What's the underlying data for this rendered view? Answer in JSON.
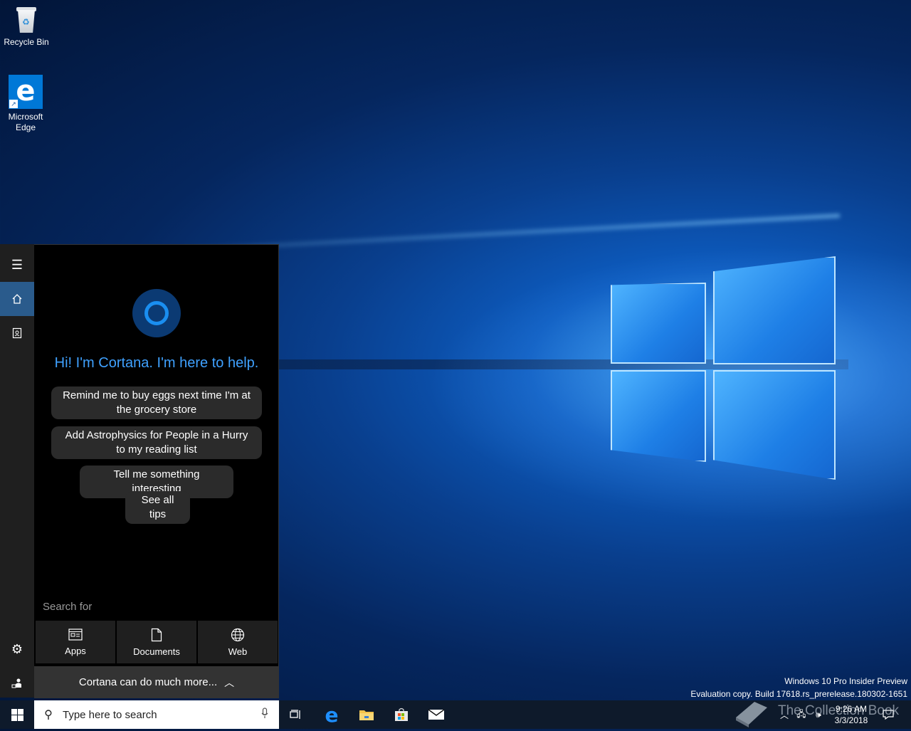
{
  "desktop": {
    "icons": [
      {
        "label": "Recycle Bin",
        "icon": "recycle-bin-icon"
      },
      {
        "label": "Microsoft Edge",
        "icon": "edge-icon"
      }
    ]
  },
  "cortana": {
    "greeting": "Hi! I'm Cortana. I'm here to help.",
    "suggestions": [
      "Remind me to buy eggs next time I'm at the grocery store",
      "Add Astrophysics for People in a Hurry to my reading list",
      "Tell me something interesting",
      "See all tips"
    ],
    "search_for_label": "Search for",
    "search_buttons": [
      {
        "label": "Apps",
        "icon": "apps-icon"
      },
      {
        "label": "Documents",
        "icon": "document-icon"
      },
      {
        "label": "Web",
        "icon": "globe-icon"
      }
    ],
    "more_label": "Cortana can do much more..."
  },
  "rail": {
    "items": [
      "menu-icon",
      "home-icon",
      "notebook-icon",
      "settings-icon",
      "feedback-icon"
    ],
    "active": "home-icon"
  },
  "watermark": {
    "line1": "Windows 10 Pro Insider Preview",
    "line2": "Evaluation copy. Build 17618.rs_prerelease.180302-1651"
  },
  "taskbar": {
    "search_placeholder": "Type here to search",
    "pinned": [
      "task-view-icon",
      "edge-icon",
      "file-explorer-icon",
      "store-icon",
      "mail-icon"
    ],
    "time": "9:26 AM",
    "date": "3/3/2018",
    "overlay_text": "The Collection Book"
  },
  "colors": {
    "accent": "#3fa1ff",
    "taskbar": "#0e1a2b",
    "panel": "#000000"
  }
}
